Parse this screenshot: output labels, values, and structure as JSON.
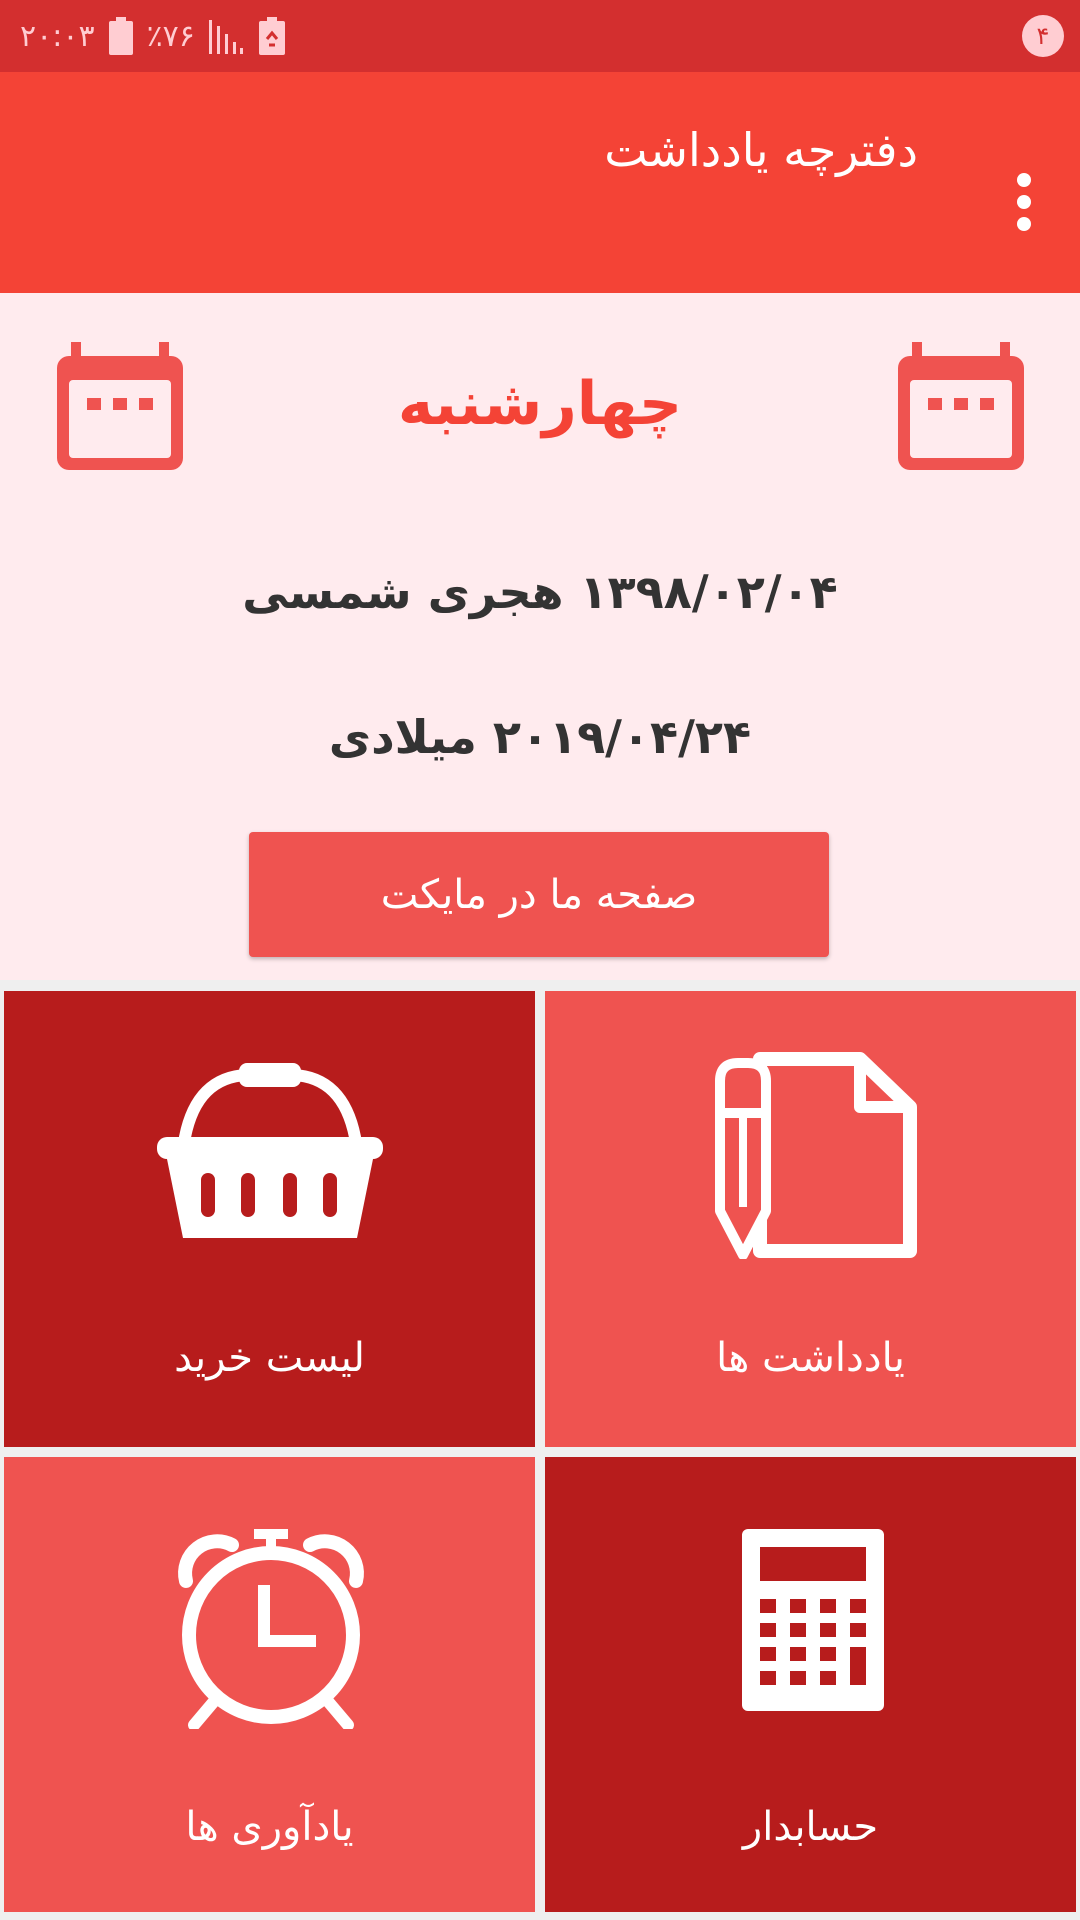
{
  "status_bar": {
    "time": "۲۰:۰۳",
    "battery_percent": "٪۷۶",
    "notification_count": "۴"
  },
  "app_bar": {
    "title": "دفترچه یادداشت",
    "overflow_icon": "more-vert-icon"
  },
  "date_panel": {
    "weekday": "چهارشنبه",
    "hijri_date": "۱۳۹۸/۰۲/۰۴",
    "hijri_label": "هجری شمسی",
    "gregorian_date": "۲۰۱۹/۰۴/۲۴",
    "gregorian_label": "میلادی",
    "calendar_icon": "calendar-icon"
  },
  "myket_button": {
    "label": "صفحه ما در مایکت"
  },
  "tiles": {
    "notes": {
      "label": "یادداشت ها",
      "icon": "note-pencil-icon"
    },
    "shopping": {
      "label": "لیست خرید",
      "icon": "shopping-basket-icon"
    },
    "accountant": {
      "label": "حسابدار",
      "icon": "calculator-icon"
    },
    "reminders": {
      "label": "یادآوری ها",
      "icon": "alarm-clock-icon"
    }
  },
  "colors": {
    "status_bar": "#d32f2f",
    "app_bar": "#f44336",
    "panel_background": "#ffebee",
    "accent": "#f44336",
    "tile_dark": "#b71c1c",
    "tile_light": "#ef5350"
  }
}
